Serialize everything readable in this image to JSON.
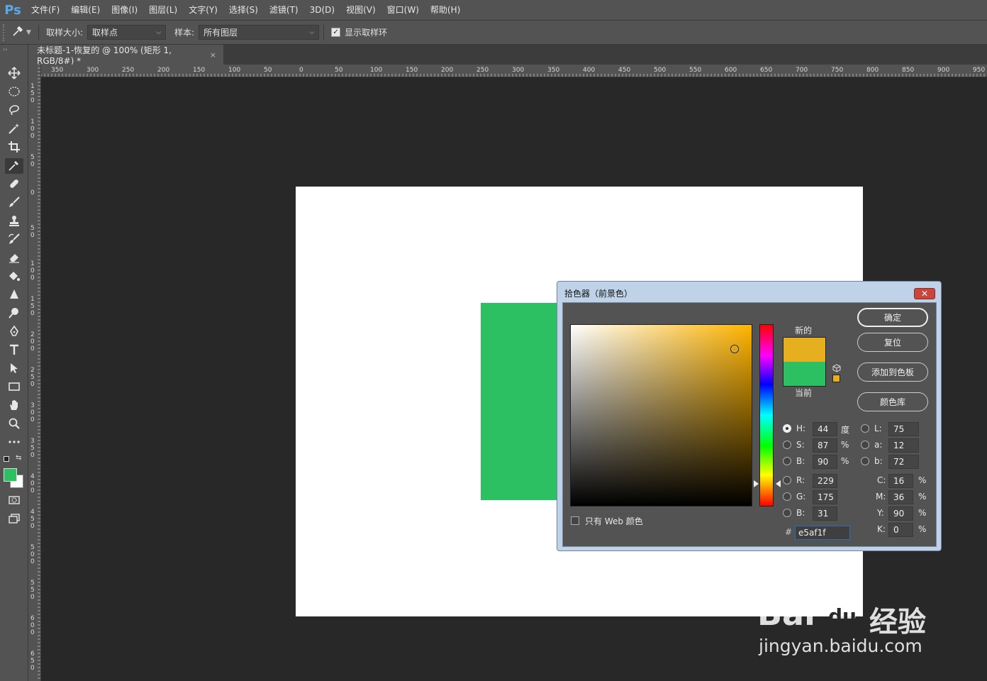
{
  "app": {
    "logo": "Ps",
    "menu": [
      "文件(F)",
      "编辑(E)",
      "图像(I)",
      "图层(L)",
      "文字(Y)",
      "选择(S)",
      "滤镜(T)",
      "3D(D)",
      "视图(V)",
      "窗口(W)",
      "帮助(H)"
    ]
  },
  "options": {
    "sample_size_label": "取样大小:",
    "sample_size_value": "取样点",
    "sample_label": "样本:",
    "sample_value": "所有图层",
    "show_ring_label": "显示取样环",
    "show_ring_checked": true
  },
  "document": {
    "tab_title": "未标题-1-恢复的 @ 100% (矩形 1, RGB/8#) *",
    "close_glyph": "×",
    "canvas_color": "#ffffff",
    "shape_color": "#2dc063"
  },
  "rulers": {
    "top": [
      "350",
      "300",
      "250",
      "200",
      "150",
      "100",
      "50",
      "0",
      "50",
      "100",
      "150",
      "200",
      "250",
      "300",
      "350",
      "400",
      "450",
      "500",
      "550",
      "600",
      "650",
      "700",
      "750",
      "800",
      "850",
      "900",
      "950"
    ],
    "left": [
      "150",
      "100",
      "50",
      "0",
      "50",
      "100",
      "150",
      "200",
      "250",
      "300",
      "350",
      "400",
      "450",
      "500",
      "550",
      "600",
      "650"
    ]
  },
  "toolbar": {
    "foreground_color": "#2dc063",
    "background_color": "#ffffff",
    "tools": [
      "move-icon",
      "marquee-icon",
      "lasso-icon",
      "magic-wand-icon",
      "crop-icon",
      "eyedropper-icon",
      "healing-icon",
      "brush-icon",
      "stamp-icon",
      "history-brush-icon",
      "eraser-icon",
      "bucket-icon",
      "blur-icon",
      "dodge-icon",
      "pen-icon",
      "type-icon",
      "path-select-icon",
      "rectangle-icon",
      "hand-icon",
      "zoom-icon",
      "more-icon"
    ]
  },
  "dialog": {
    "title": "拾色器（前景色）",
    "close_glyph": "✕",
    "new_label": "新的",
    "current_label": "当前",
    "new_color": "#e5af1f",
    "current_color": "#2dc063",
    "buttons": {
      "ok": "确定",
      "reset": "复位",
      "add_swatch": "添加到色板",
      "libraries": "颜色库"
    },
    "fields": {
      "H": {
        "label": "H:",
        "value": "44",
        "unit": "度"
      },
      "S": {
        "label": "S:",
        "value": "87",
        "unit": "%"
      },
      "Bv": {
        "label": "B:",
        "value": "90",
        "unit": "%"
      },
      "R": {
        "label": "R:",
        "value": "229"
      },
      "G": {
        "label": "G:",
        "value": "175"
      },
      "Bb": {
        "label": "B:",
        "value": "31"
      },
      "L": {
        "label": "L:",
        "value": "75"
      },
      "a": {
        "label": "a:",
        "value": "12"
      },
      "b": {
        "label": "b:",
        "value": "72"
      },
      "C": {
        "label": "C:",
        "value": "16",
        "unit": "%"
      },
      "M": {
        "label": "M:",
        "value": "36",
        "unit": "%"
      },
      "Y": {
        "label": "Y:",
        "value": "90",
        "unit": "%"
      },
      "K": {
        "label": "K:",
        "value": "0",
        "unit": "%"
      }
    },
    "selected_mode": "H",
    "web_only_label": "只有 Web 颜色",
    "web_only_checked": false,
    "hex_prefix": "#",
    "hex_value": "e5af1f"
  },
  "watermark": {
    "brand": "Bai",
    "brand_accent": "du",
    "cn": "经验",
    "url": "jingyan.baidu.com"
  }
}
